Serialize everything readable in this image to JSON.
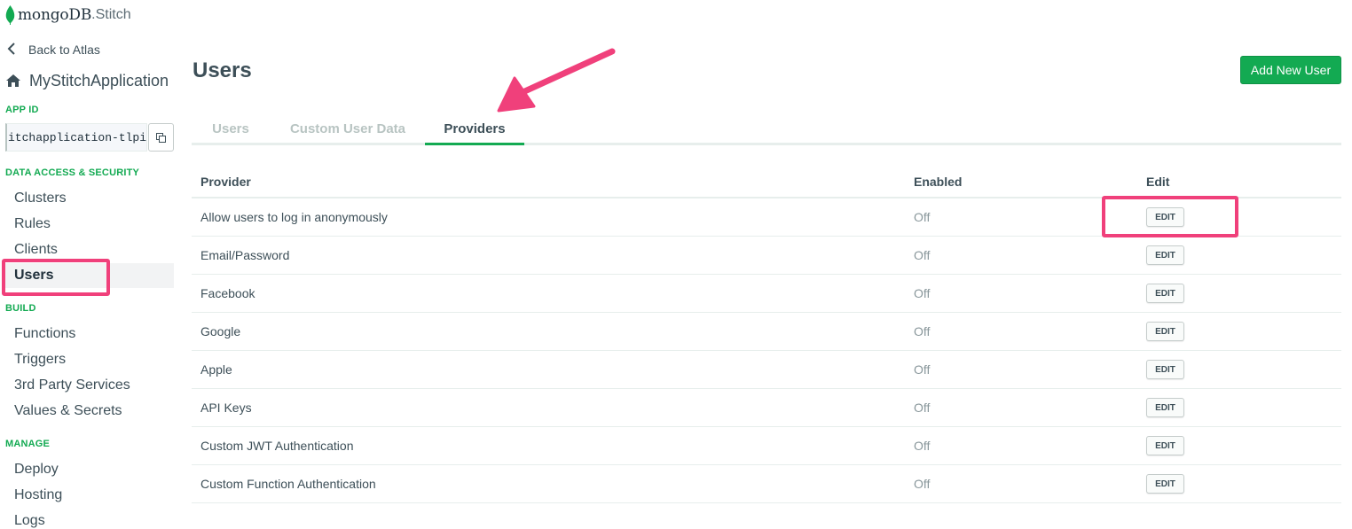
{
  "logo": {
    "brand": "mongoDB",
    "suffix": "Stitch"
  },
  "sidebar": {
    "back_label": "Back to Atlas",
    "app_name": "MyStitchApplication",
    "app_id_label": "APP ID",
    "app_id_value": "itchapplication-tlpid",
    "sections": {
      "data_access": "DATA ACCESS & SECURITY",
      "build": "BUILD",
      "manage": "MANAGE"
    },
    "items": {
      "clusters": "Clusters",
      "rules": "Rules",
      "clients": "Clients",
      "users": "Users",
      "functions": "Functions",
      "triggers": "Triggers",
      "third_party": "3rd Party Services",
      "values": "Values & Secrets",
      "deploy": "Deploy",
      "hosting": "Hosting",
      "logs": "Logs"
    },
    "active_item": "Users"
  },
  "main": {
    "title": "Users",
    "add_button": "Add New User",
    "tabs": [
      {
        "label": "Users"
      },
      {
        "label": "Custom User Data"
      },
      {
        "label": "Providers"
      }
    ],
    "active_tab": "Providers",
    "table": {
      "headers": {
        "provider": "Provider",
        "enabled": "Enabled",
        "edit": "Edit"
      },
      "edit_label": "EDIT",
      "rows": [
        {
          "provider": "Allow users to log in anonymously",
          "enabled": "Off"
        },
        {
          "provider": "Email/Password",
          "enabled": "Off"
        },
        {
          "provider": "Facebook",
          "enabled": "Off"
        },
        {
          "provider": "Google",
          "enabled": "Off"
        },
        {
          "provider": "Apple",
          "enabled": "Off"
        },
        {
          "provider": "API Keys",
          "enabled": "Off"
        },
        {
          "provider": "Custom JWT Authentication",
          "enabled": "Off"
        },
        {
          "provider": "Custom Function Authentication",
          "enabled": "Off"
        }
      ]
    }
  },
  "colors": {
    "brand_green": "#13aa52",
    "annotation_pink": "#f0407b",
    "text_dark": "#3d4f58",
    "text_muted": "#89979b"
  },
  "icons": [
    "leaf-logo-icon",
    "chevron-left-icon",
    "home-icon",
    "copy-icon",
    "annotation-arrow"
  ]
}
